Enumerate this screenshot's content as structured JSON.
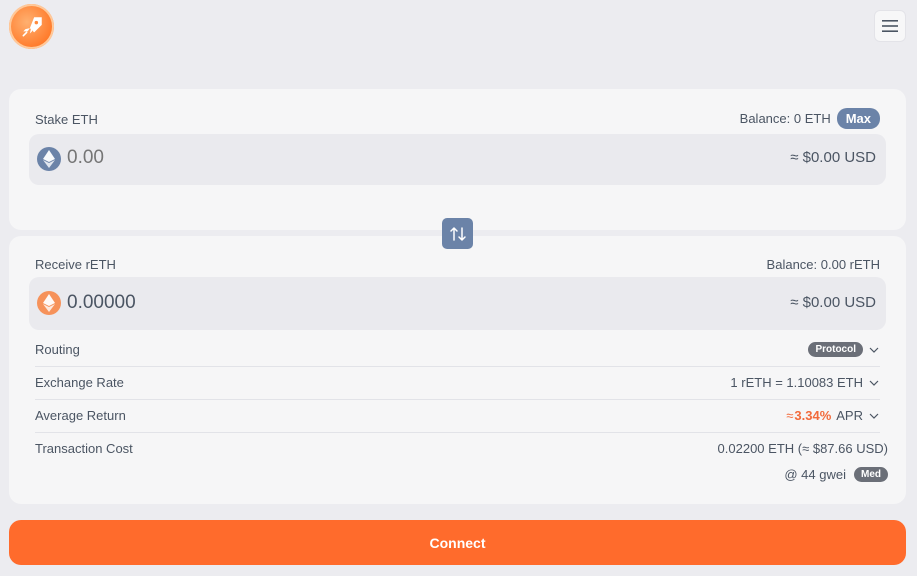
{
  "header": {
    "logo_icon": "rocket-icon",
    "menu_icon": "hamburger-menu-icon"
  },
  "stake": {
    "label": "Stake ETH",
    "balance": "Balance: 0 ETH",
    "max_label": "Max",
    "amount_placeholder": "0.00",
    "usd_value": "≈  $0.00 USD",
    "token_icon": "eth-icon"
  },
  "swap": {
    "icon": "swap-arrows-icon"
  },
  "receive": {
    "label": "Receive rETH",
    "balance": "Balance: 0.00 rETH",
    "amount": "0.00000",
    "usd_value": "≈  $0.00 USD",
    "token_icon": "reth-icon"
  },
  "details": {
    "routing": {
      "label": "Routing",
      "value": "Protocol"
    },
    "exchange_rate": {
      "label": "Exchange Rate",
      "value": "1 rETH = 1.10083 ETH"
    },
    "average_return": {
      "label": "Average Return",
      "prefix": "≈ ",
      "percent": "3.34%",
      "suffix": "APR"
    },
    "transaction_cost": {
      "label": "Transaction Cost",
      "value": "0.02200 ETH (≈ $87.66 USD)",
      "gas": "@ 44 gwei",
      "speed": "Med"
    }
  },
  "connect_label": "Connect",
  "colors": {
    "accent": "#ff6b2c",
    "slate": "#6b83a8",
    "apr": "#f26a3b"
  }
}
